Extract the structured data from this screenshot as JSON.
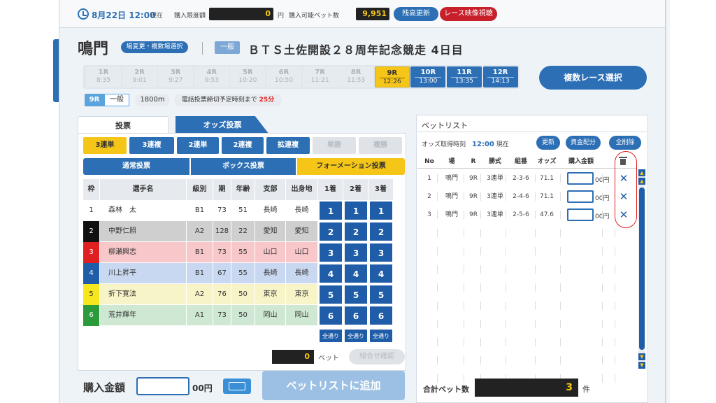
{
  "topbar": {
    "date": "8月22日 12:00",
    "now": "現在",
    "limit_label": "購入限度額",
    "limit_value": "0",
    "yen": "円",
    "possible_label": "購入可能ベット数",
    "possible_value": "9,951",
    "balance_update": "残高更新",
    "video": "レース映像視聴"
  },
  "header": {
    "venue": "鳴門",
    "venue_change": "場変更・複数場選択",
    "grade": "一般",
    "race_name": "ＢＴＳ土佐開設２８周年記念競走 4日目"
  },
  "races": [
    {
      "label": "1R",
      "time": "8:35",
      "state": "past"
    },
    {
      "label": "2R",
      "time": "9:01",
      "state": "past"
    },
    {
      "label": "3R",
      "time": "9:27",
      "state": "past"
    },
    {
      "label": "4R",
      "time": "9:53",
      "state": "past"
    },
    {
      "label": "5R",
      "time": "10:20",
      "state": "past"
    },
    {
      "label": "6R",
      "time": "10:50",
      "state": "past"
    },
    {
      "label": "7R",
      "time": "11:21",
      "state": "past"
    },
    {
      "label": "8R",
      "time": "11:53",
      "state": "past"
    },
    {
      "label": "9R",
      "time": "12:26",
      "state": "cur"
    },
    {
      "label": "10R",
      "time": "13:00",
      "state": "fut"
    },
    {
      "label": "11R",
      "time": "13:35",
      "state": "fut"
    },
    {
      "label": "12R",
      "time": "14:13",
      "state": "fut"
    }
  ],
  "multi_race": "複数レース選択",
  "info": {
    "race": "9R",
    "grade": "一般",
    "distance": "1800m",
    "deadline_text": "電話投票締切予定時刻まで",
    "deadline_min": "25分"
  },
  "tabs": {
    "vote": "投票",
    "odds": "オッズ投票"
  },
  "bet_types": [
    "3連単",
    "3連複",
    "2連単",
    "2連複",
    "拡連複",
    "単勝",
    "複勝"
  ],
  "select_modes": [
    "通常投票",
    "ボックス投票",
    "フォーメーション投票"
  ],
  "table": {
    "headers": [
      "枠",
      "選手名",
      "級別",
      "期",
      "年齢",
      "支部",
      "出身地",
      "1着",
      "2着",
      "3着"
    ],
    "rows": [
      {
        "waku": "1",
        "name": "森林　太",
        "cls": "B1",
        "ki": "73",
        "age": "51",
        "branch": "長崎",
        "origin": "長崎"
      },
      {
        "waku": "2",
        "name": "中野仁照",
        "cls": "A2",
        "ki": "128",
        "age": "22",
        "branch": "愛知",
        "origin": "愛知"
      },
      {
        "waku": "3",
        "name": "柳瀬興志",
        "cls": "B1",
        "ki": "73",
        "age": "55",
        "branch": "山口",
        "origin": "山口"
      },
      {
        "waku": "4",
        "name": "川上昇平",
        "cls": "B1",
        "ki": "67",
        "age": "55",
        "branch": "長崎",
        "origin": "長崎"
      },
      {
        "waku": "5",
        "name": "折下寛法",
        "cls": "A2",
        "ki": "76",
        "age": "50",
        "branch": "東京",
        "origin": "東京"
      },
      {
        "waku": "6",
        "name": "荒井輝年",
        "cls": "A1",
        "ki": "73",
        "age": "50",
        "branch": "岡山",
        "origin": "岡山"
      }
    ],
    "all_label": "全通り",
    "frame_colors": [
      "#ffffff",
      "#111111",
      "#e02020",
      "#1f5da8",
      "#f5e61e",
      "#2a9a3a"
    ],
    "row_bg": [
      "#ffffff",
      "#cfcfcf",
      "#f7c7c9",
      "#c9d8f1",
      "#f7f4c8",
      "#cfe8d3"
    ]
  },
  "bet_count": "0",
  "bet_unit": "ベット",
  "combo_confirm": "組合せ確認",
  "amount_label": "購入金額",
  "amount_unit": "00円",
  "add_to_list": "ベットリストに追加",
  "betlist": {
    "title": "ベットリスト",
    "odds_time_label": "オッズ取得時刻",
    "odds_time": "12:00",
    "now": "現在",
    "btn_update": "更新",
    "btn_funds": "資金配分",
    "btn_clear": "全削除",
    "headers": [
      "No",
      "場",
      "R",
      "勝式",
      "組番",
      "オッズ",
      "購入金額"
    ],
    "rows": [
      {
        "no": "1",
        "place": "鳴門",
        "race": "9R",
        "type": "3連単",
        "combo": "2-3-6",
        "odds": "71.1",
        "unit": "00円"
      },
      {
        "no": "2",
        "place": "鳴門",
        "race": "9R",
        "type": "3連単",
        "combo": "2-4-6",
        "odds": "71.1",
        "unit": "00円"
      },
      {
        "no": "3",
        "place": "鳴門",
        "race": "9R",
        "type": "3連単",
        "combo": "2-5-6",
        "odds": "47.6",
        "unit": "00円"
      }
    ],
    "total_label": "合計ベット数",
    "total_value": "3",
    "total_unit": "件"
  }
}
